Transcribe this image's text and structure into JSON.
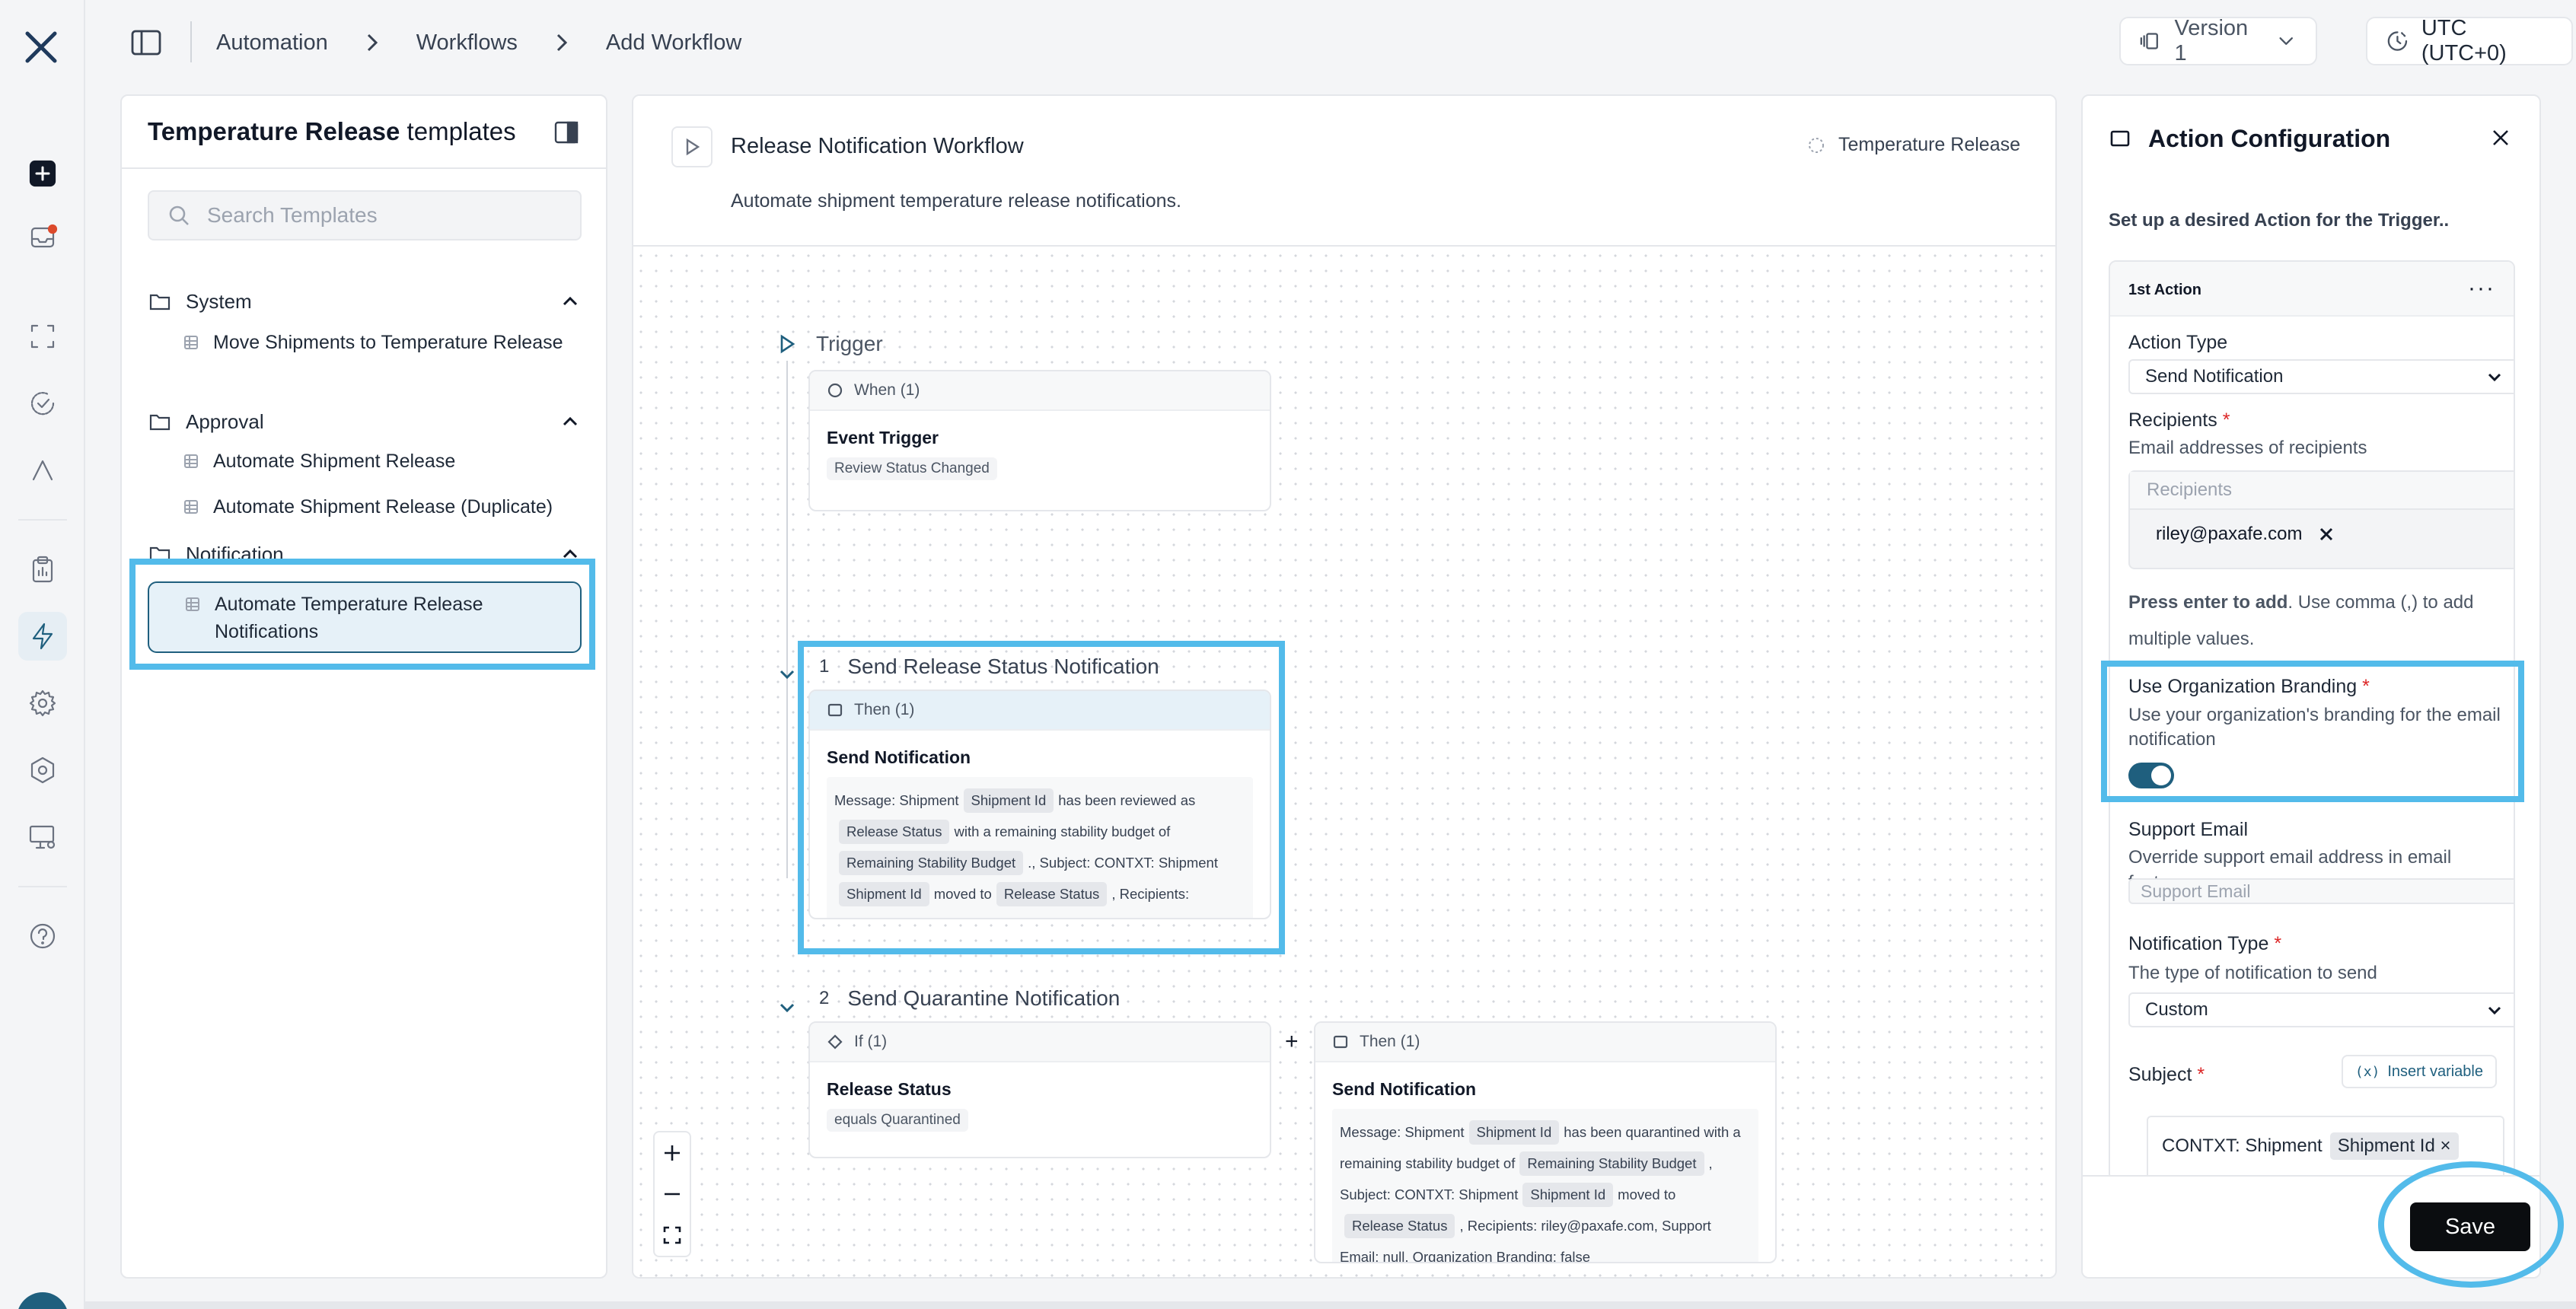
{
  "topbar": {
    "breadcrumbs": [
      "Automation",
      "Workflows",
      "Add Workflow"
    ],
    "version_label": "Version 1",
    "timezone_label": "UTC (UTC+0)"
  },
  "rail": {
    "icons": [
      "logo-x-icon",
      "plus-square-icon",
      "inbox-icon",
      "scan-icon",
      "check-circle-icon",
      "lambda-icon",
      "clipboard-icon",
      "lightning-icon",
      "gear-icon",
      "hexagon-icon",
      "monitor-settings-icon",
      "help-icon"
    ],
    "active": "lightning-icon",
    "notification_color": "#dc4a2c"
  },
  "templates": {
    "title_bold": "Temperature Release",
    "title_rest": " templates",
    "search_placeholder": "Search Templates",
    "groups": [
      {
        "label": "System",
        "items": [
          "Move Shipments to Temperature Release"
        ]
      },
      {
        "label": "Approval",
        "items": [
          "Automate Shipment Release",
          "Automate Shipment Release (Duplicate)"
        ]
      },
      {
        "label": "Notification",
        "items": [
          "Automate Temperature Release Notifications"
        ]
      }
    ]
  },
  "workflow": {
    "name": "Release Notification Workflow",
    "description": "Automate shipment temperature release notifications.",
    "tag": "Temperature Release",
    "trigger_label": "Trigger",
    "trigger_card": {
      "header": "When (1)",
      "title": "Event Trigger",
      "chip": "Review Status Changed"
    },
    "step1": {
      "number": "1",
      "label": "Send Release Status Notification",
      "header": "Then (1)",
      "title": "Send Notification",
      "msg": {
        "t1": "Message: Shipment",
        "v1": "Shipment Id",
        "t2": "has been reviewed as",
        "v2": "Release Status",
        "t3": "with a remaining stability budget of",
        "v3": "Remaining Stability Budget",
        "t4": "., Subject: CONTXT: Shipment",
        "v4": "Shipment Id",
        "t5": "moved to",
        "v5": "Release Status",
        "t6": ", Recipients: riley@paxafe.com, Support Email: null, Organization Branding:"
      }
    },
    "step2": {
      "number": "2",
      "label": "Send Quarantine Notification",
      "if_header": "If (1)",
      "if_title": "Release Status",
      "if_chip": "equals Quarantined",
      "plus": "+",
      "then_header": "Then (1)",
      "then_title": "Send Notification",
      "msg": {
        "t1": "Message: Shipment",
        "v1": "Shipment Id",
        "t2": "has been quarantined with a remaining stability budget of",
        "v2": "Remaining Stability Budget",
        "t3": ", Subject: CONTXT: Shipment",
        "v3": "Shipment Id",
        "t4": "moved to",
        "v4": "Release Status",
        "t5": ", Recipients: riley@paxafe.com, Support Email: null, Organization Branding: false"
      }
    }
  },
  "action_config": {
    "title": "Action Configuration",
    "subtitle": "Set up a desired Action for the Trigger..",
    "action_index": "1st Action",
    "more": "···",
    "action_type_label": "Action Type",
    "action_type_value": "Send Notification",
    "recipients_label": "Recipients",
    "required_mark": "*",
    "recipients_hint": "Email addresses of recipients",
    "recipients_placeholder": "Recipients",
    "recipient": "riley@paxafe.com",
    "recipients_help_bold": "Press enter to add",
    "recipients_help_rest": ". Use comma (,) to add multiple values.",
    "branding_label": "Use Organization Branding",
    "branding_hint": "Use your organization's branding for the email notification",
    "branding_on": true,
    "support_label": "Support Email",
    "support_hint": "Override support email address in email footers",
    "support_placeholder": "Support Email",
    "notif_type_label": "Notification Type",
    "notif_type_hint": "The type of notification to send",
    "notif_type_value": "Custom",
    "subject_label": "Subject",
    "insert_variable": "Insert variable",
    "subject_text": "CONTXT: Shipment",
    "subject_var": "Shipment Id",
    "save_label": "Save"
  },
  "colors": {
    "accent": "#1f5f7e",
    "highlight": "#53bbea",
    "save_bg": "#0b0d10"
  }
}
